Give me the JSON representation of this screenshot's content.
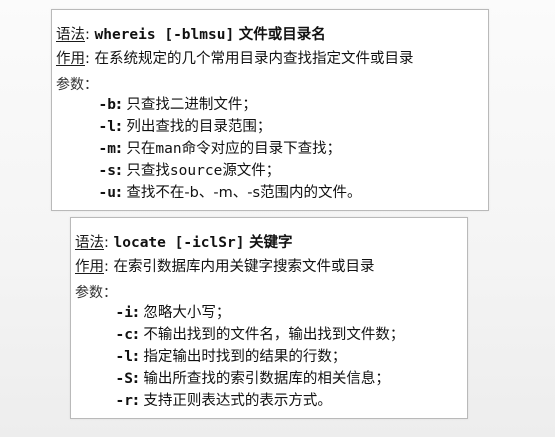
{
  "card1": {
    "syntax_label": "语法",
    "colon": ":",
    "command": "whereis [-blmsu]",
    "command_desc": "文件或目录名",
    "usage_label": "作用",
    "usage_text": "在系统规定的几个常用目录内查找指定文件或目录",
    "params_label": "参数：",
    "params": [
      {
        "opt": "-b",
        "sep": ":",
        "text": "只查找二进制文件；"
      },
      {
        "opt": "-l",
        "sep": ":",
        "text": "列出查找的目录范围；"
      },
      {
        "opt": "-m",
        "sep": ":",
        "pre": "只在",
        "mono": "man",
        "text": "命令对应的目录下查找；"
      },
      {
        "opt": "-s",
        "sep": ":",
        "pre": "只查找",
        "mono": "source",
        "text": "源文件；"
      },
      {
        "opt": "-u",
        "sep": ":",
        "text": "查找不在-b、-m、-s范围内的文件。"
      }
    ]
  },
  "card2": {
    "syntax_label": "语法",
    "colon": ":",
    "command": "locate [-iclSr]",
    "command_desc": "关键字",
    "usage_label": "作用",
    "usage_text": "在索引数据库内用关键字搜索文件或目录",
    "params_label": "参数：",
    "params": [
      {
        "opt": "-i",
        "sep": ":",
        "text": "忽略大小写；"
      },
      {
        "opt": "-c",
        "sep": ":",
        "text": "不输出找到的文件名，输出找到文件数；"
      },
      {
        "opt": "-l",
        "sep": ":",
        "text": "指定输出时找到的结果的行数；"
      },
      {
        "opt": "-S",
        "sep": ":",
        "text": "输出所查找的索引数据库的相关信息；"
      },
      {
        "opt": "-r",
        "sep": ":",
        "text": "支持正则表达式的表示方式。"
      }
    ]
  }
}
